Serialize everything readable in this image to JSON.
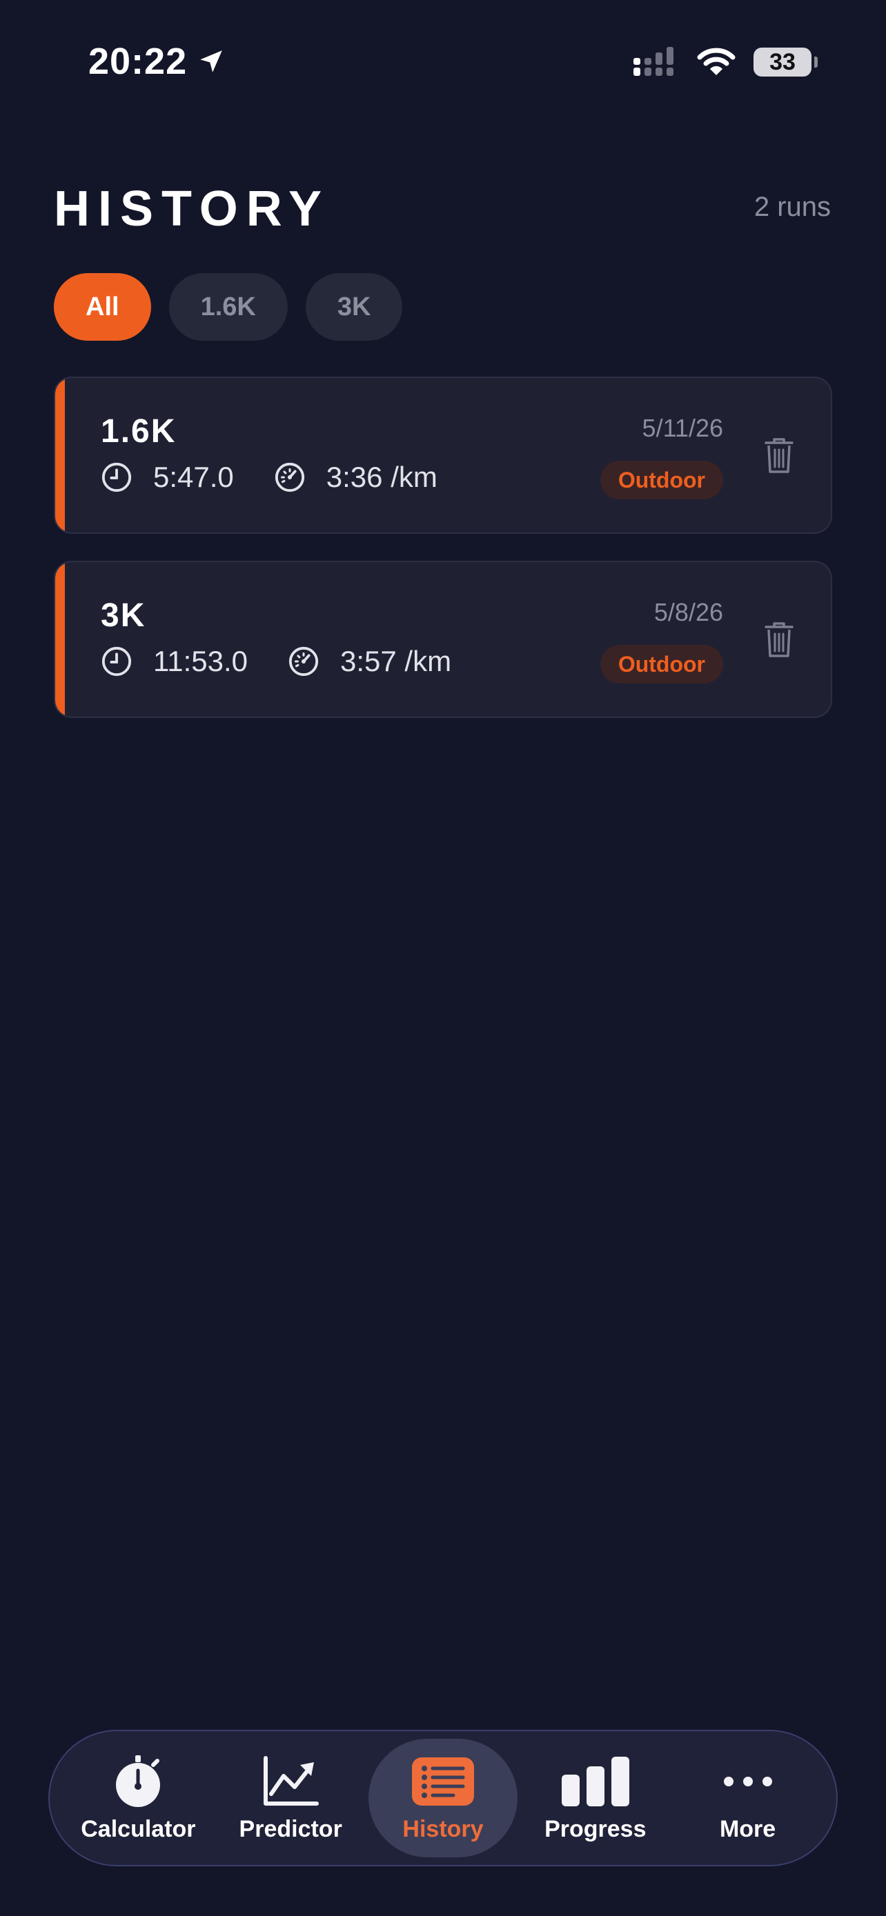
{
  "status_bar": {
    "time": "20:22",
    "battery": "33"
  },
  "header": {
    "title": "HISTORY",
    "run_count": "2 runs"
  },
  "filters": [
    {
      "label": "All",
      "active": true
    },
    {
      "label": "1.6K",
      "active": false
    },
    {
      "label": "3K",
      "active": false
    }
  ],
  "runs": [
    {
      "distance": "1.6K",
      "date": "5/11/26",
      "time": "5:47.0",
      "pace": "3:36 /km",
      "badge": "Outdoor"
    },
    {
      "distance": "3K",
      "date": "5/8/26",
      "time": "11:53.0",
      "pace": "3:57 /km",
      "badge": "Outdoor"
    }
  ],
  "tabs": [
    {
      "label": "Calculator",
      "icon": "stopwatch-icon"
    },
    {
      "label": "Predictor",
      "icon": "trend-chart-icon"
    },
    {
      "label": "History",
      "icon": "list-icon",
      "active": true
    },
    {
      "label": "Progress",
      "icon": "bar-chart-icon"
    },
    {
      "label": "More",
      "icon": "ellipsis-icon"
    }
  ],
  "colors": {
    "background": "#131629",
    "accent": "#ee5f1f",
    "card": "#1f2133",
    "muted_text": "#8b8e9c"
  }
}
